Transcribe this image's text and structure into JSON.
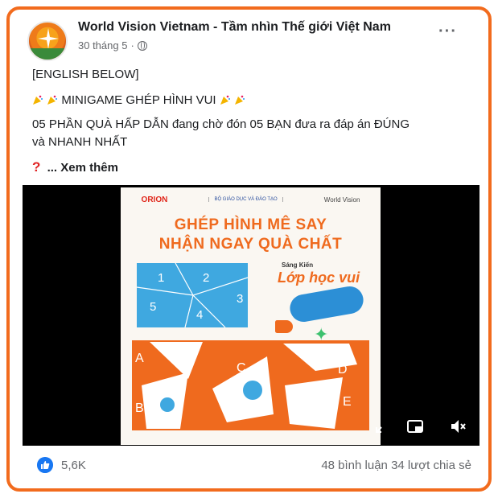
{
  "post": {
    "page_name": "World Vision Vietnam - Tầm nhìn Thế giới Việt Nam",
    "date": "30 tháng 5",
    "date_separator": "·",
    "more_label": "···",
    "lines": {
      "english_below": "[ENGLISH BELOW]",
      "minigame": "MINIGAME GHÉP HÌNH VUI",
      "prize_line1": "05 PHẦN QUÀ HẤP DẪN đang chờ đón 05 BẠN đưa ra đáp án ĐÚNG",
      "prize_line2": "và NHANH NHẤT",
      "see_more": "... Xem thêm",
      "question_mark": "?"
    }
  },
  "poster": {
    "logo_orion": "ORION",
    "logo_moe": "BỘ GIÁO DỤC VÀ ĐÀO TẠO",
    "logo_wv": "World Vision",
    "headline_1": "GHÉP HÌNH MÊ SAY",
    "headline_2": "NHẬN NGAY QUÀ CHẤT",
    "sang_kien": "Sáng Kiến",
    "lop_hoc_vui": "Lớp học vui",
    "puzzle_numbers": [
      "1",
      "2",
      "3",
      "4",
      "5"
    ],
    "piece_letters": [
      "A",
      "B",
      "C",
      "D",
      "E"
    ]
  },
  "video_controls": {
    "expand": "expand-icon",
    "minimize": "minimize-icon",
    "mute": "mute-icon"
  },
  "footer": {
    "likes": "5,6K",
    "comments": "48 bình luận",
    "shares": "34 lượt chia sẻ"
  },
  "colors": {
    "border_accent": "#f26b1d",
    "facebook_blue": "#1877f2",
    "poster_orange": "#ef6a1e",
    "poster_blue": "#3fa8e0"
  }
}
